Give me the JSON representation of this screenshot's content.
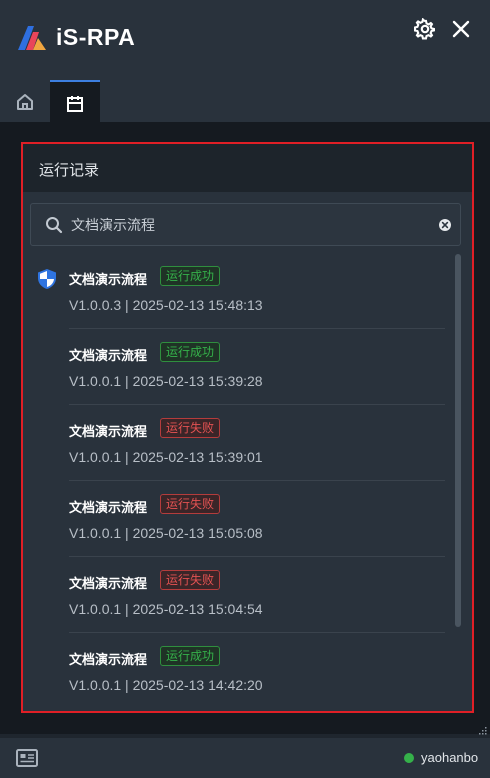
{
  "app": {
    "title": "iS-RPA"
  },
  "tabs": [
    {
      "icon": "home-icon",
      "active": false
    },
    {
      "icon": "calendar-icon",
      "active": true
    }
  ],
  "panel": {
    "title": "运行记录",
    "search": {
      "value": "文档演示流程"
    }
  },
  "records": [
    {
      "name": "文档演示流程",
      "status": "运行成功",
      "status_type": "success",
      "meta": "V1.0.0.3 | 2025-02-13 15:48:13",
      "icon": "shield-icon"
    },
    {
      "name": "文档演示流程",
      "status": "运行成功",
      "status_type": "success",
      "meta": "V1.0.0.1 | 2025-02-13 15:39:28"
    },
    {
      "name": "文档演示流程",
      "status": "运行失败",
      "status_type": "fail",
      "meta": "V1.0.0.1 | 2025-02-13 15:39:01"
    },
    {
      "name": "文档演示流程",
      "status": "运行失败",
      "status_type": "fail",
      "meta": "V1.0.0.1 | 2025-02-13 15:05:08"
    },
    {
      "name": "文档演示流程",
      "status": "运行失败",
      "status_type": "fail",
      "meta": "V1.0.0.1 | 2025-02-13 15:04:54"
    },
    {
      "name": "文档演示流程",
      "status": "运行成功",
      "status_type": "success",
      "meta": "V1.0.0.1 | 2025-02-13 14:42:20"
    }
  ],
  "statusbar": {
    "username": "yaohanbo",
    "online": true
  },
  "colors": {
    "accent": "#3d7fe0",
    "success": "#35b14a",
    "fail": "#e25252",
    "highlight_border": "#e01f26"
  }
}
